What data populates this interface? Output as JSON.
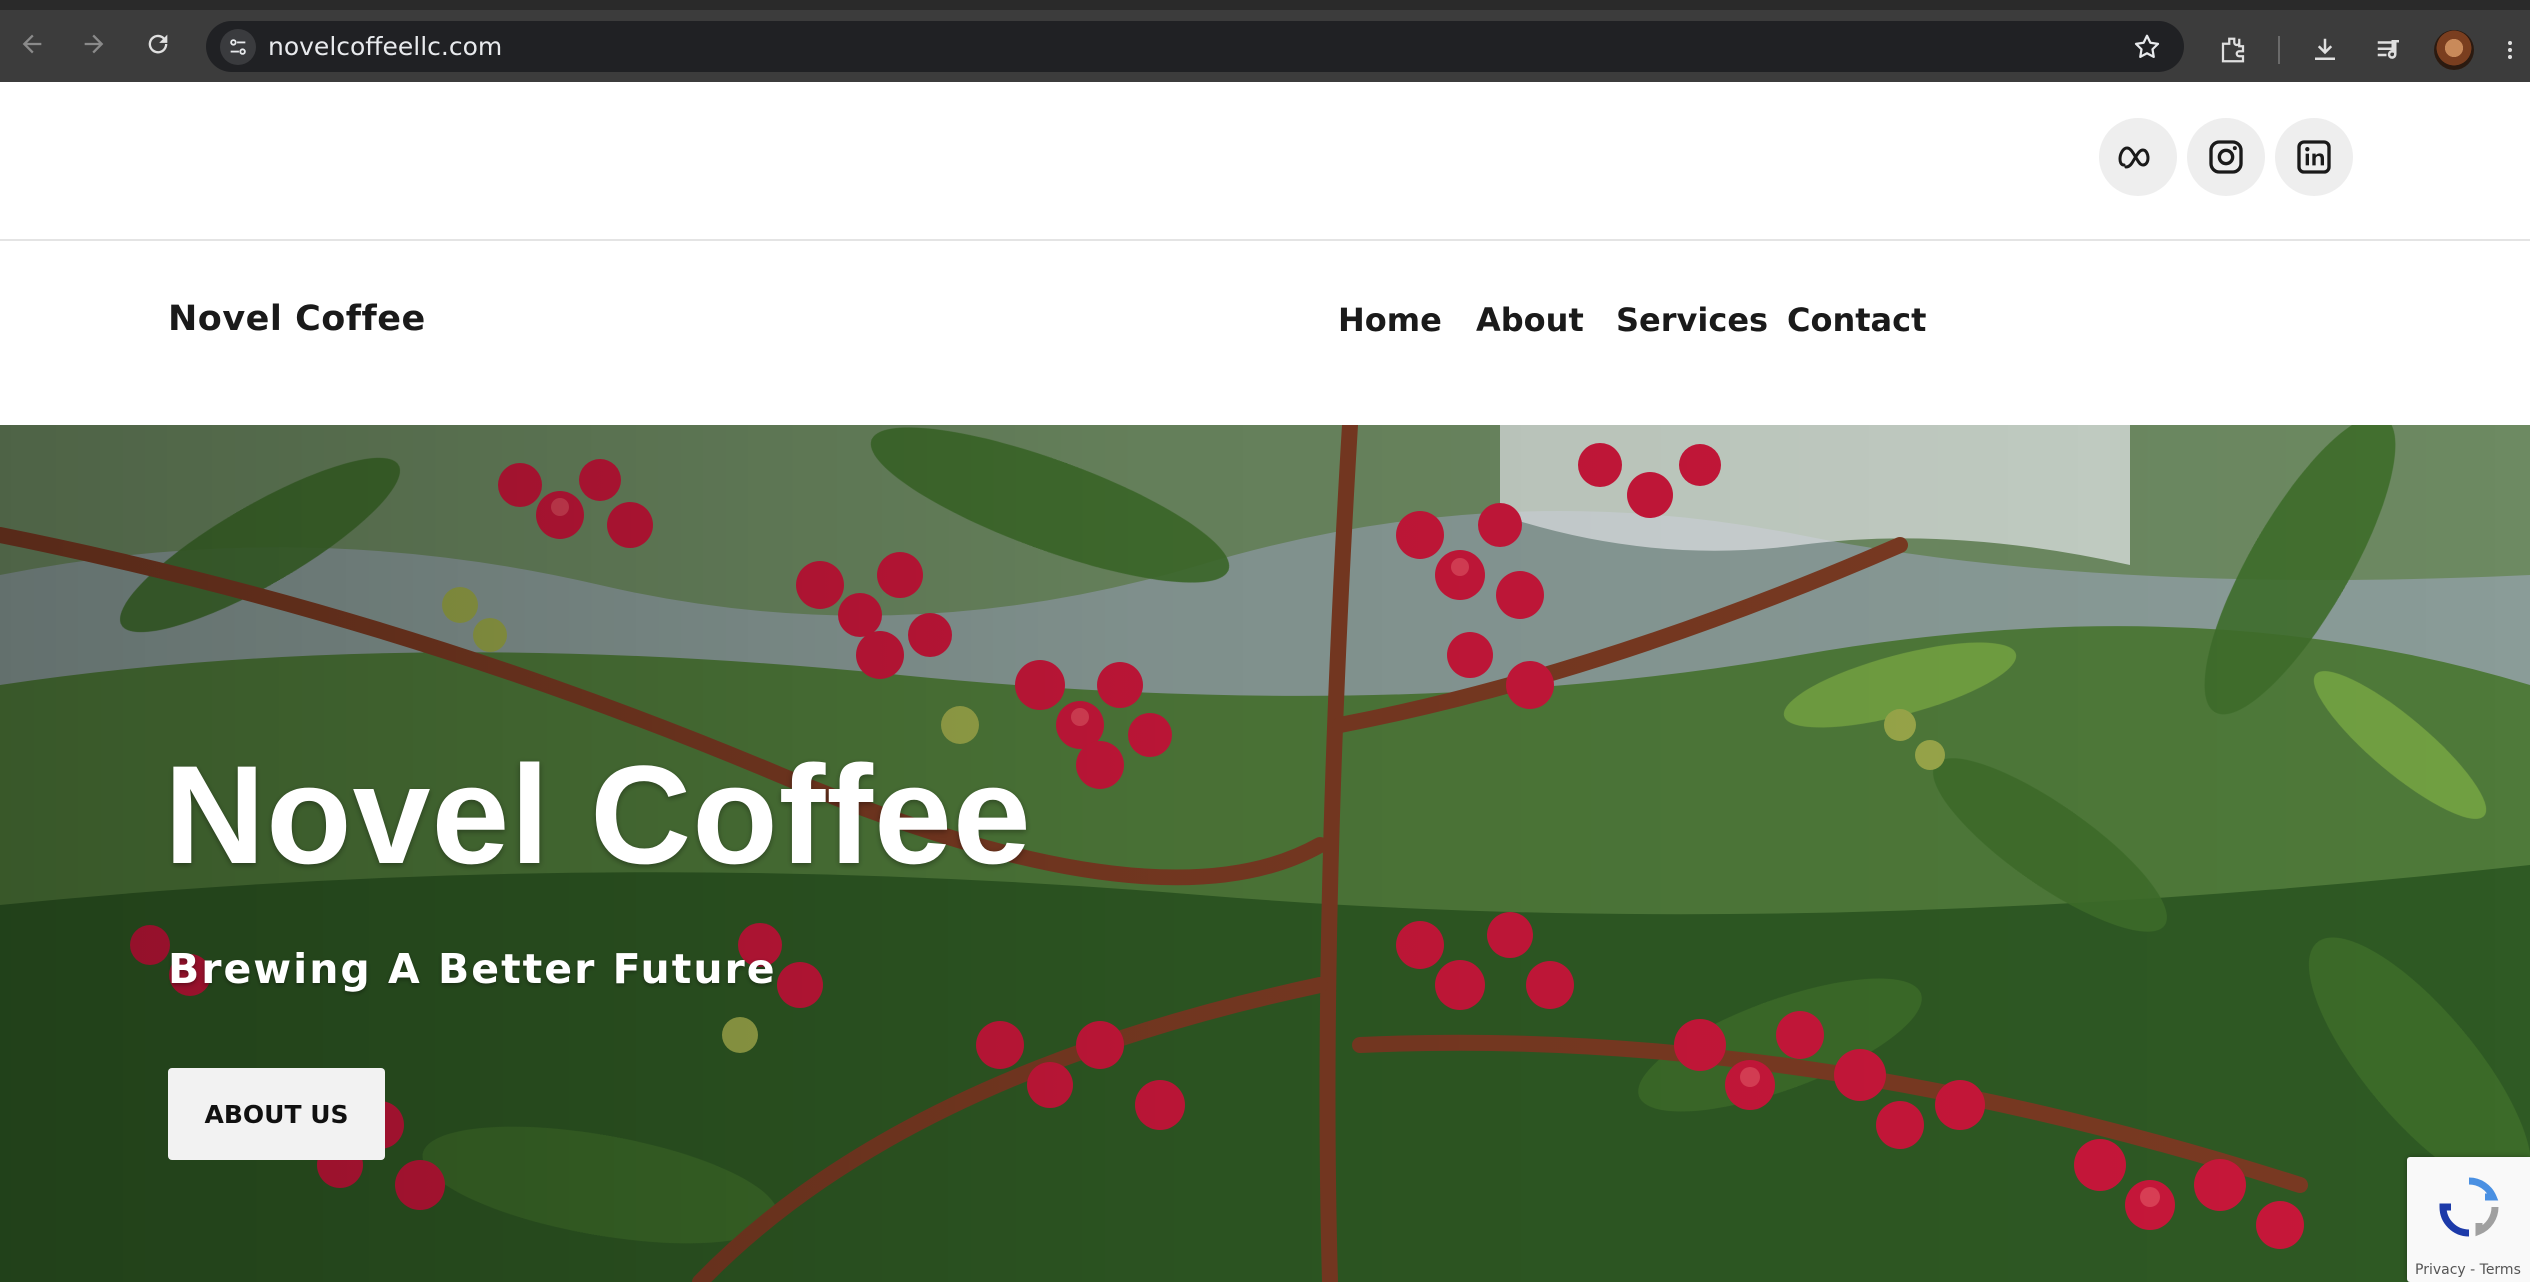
{
  "browser": {
    "url": "novelcoffeellc.com",
    "icons": [
      "back-arrow-icon",
      "forward-arrow-icon",
      "reload-icon",
      "site-info-icon",
      "bookmark-star-icon",
      "extensions-icon",
      "download-icon",
      "media-controls-icon",
      "profile-avatar"
    ]
  },
  "social": {
    "items": [
      {
        "name": "meta",
        "icon": "meta-icon"
      },
      {
        "name": "instagram",
        "icon": "instagram-icon"
      },
      {
        "name": "linkedin",
        "icon": "linkedin-icon"
      }
    ]
  },
  "header": {
    "brand": "Novel Coffee",
    "nav": [
      "Home",
      "About",
      "Services",
      "Contact"
    ]
  },
  "hero": {
    "title": "Novel Coffee",
    "subtitle": "Brewing A Better Future",
    "button_label": "ABOUT US"
  },
  "recaptcha": {
    "text": "Privacy - Terms"
  },
  "colors": {
    "chrome_bar": "#3c3c3c",
    "omnibox": "#202124",
    "text_dark": "#1a1a1a",
    "social_bg": "#eeeeee",
    "button_bg": "#f2f2f2"
  }
}
